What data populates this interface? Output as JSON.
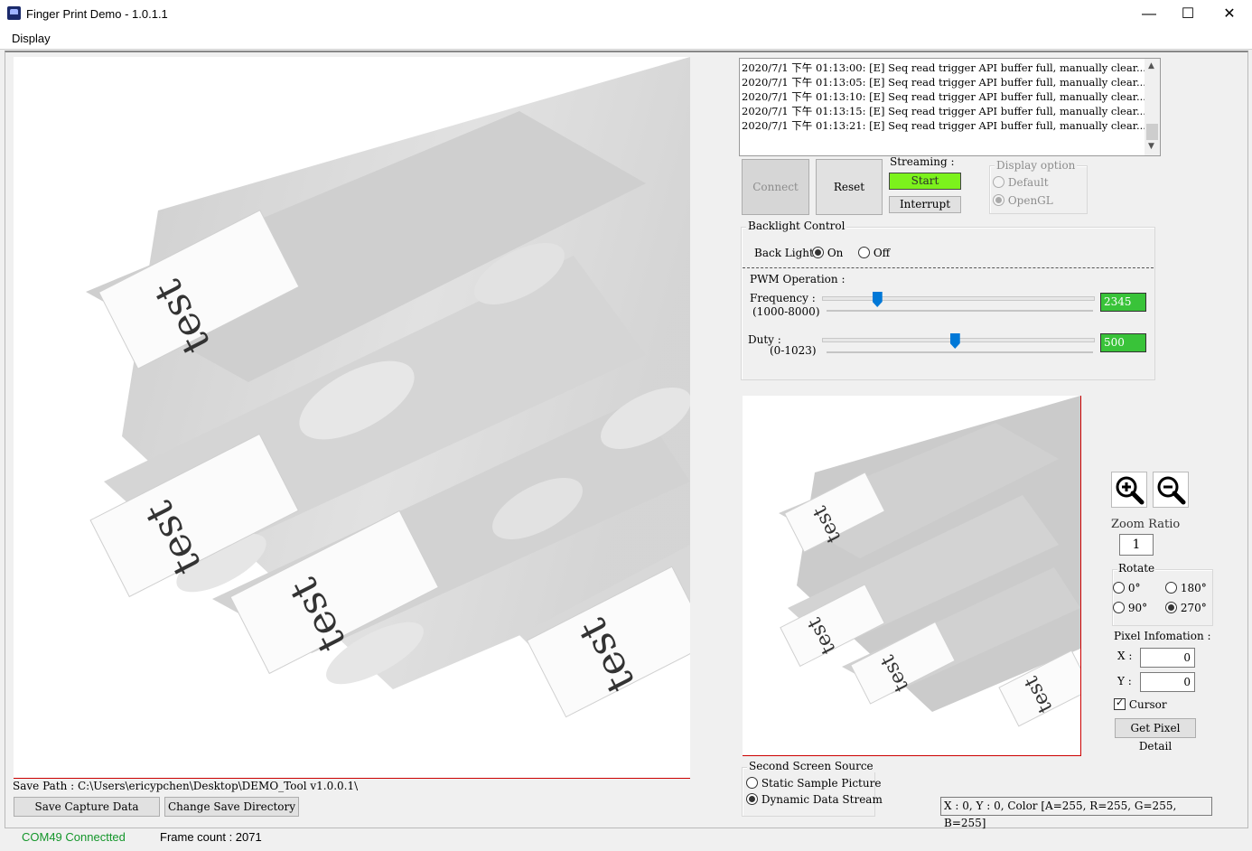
{
  "window": {
    "title": "Finger Print Demo - 1.0.1.1",
    "minimize": "—",
    "maximize": "☐",
    "close": "✕"
  },
  "menu": {
    "display": "Display"
  },
  "main_image": {
    "labels": [
      "test",
      "test",
      "test",
      "test"
    ]
  },
  "save": {
    "path_text": "Save Path : C:\\Users\\ericypchen\\Desktop\\DEMO_Tool v1.0.0.1\\",
    "save_button": "Save Capture Data",
    "change_dir_button": "Change Save Directory"
  },
  "status": {
    "connection": "COM49 Connectted",
    "frame_count": "Frame count : 2071",
    "connection_color": "#14962b"
  },
  "log": {
    "lines": [
      "2020/7/1 下午 01:13:00: [E] Seq read trigger API buffer full, manually clear....",
      "2020/7/1 下午 01:13:05: [E] Seq read trigger API buffer full, manually clear....",
      "2020/7/1 下午 01:13:10: [E] Seq read trigger API buffer full, manually clear....",
      "2020/7/1 下午 01:13:15: [E] Seq read trigger API buffer full, manually clear....",
      "2020/7/1 下午 01:13:21: [E] Seq read trigger API buffer full, manually clear...."
    ]
  },
  "controls": {
    "connect": "Connect",
    "reset": "Reset",
    "streaming_label": "Streaming :",
    "start": "Start",
    "interrupt": "Interrupt",
    "display_option": {
      "title": "Display option",
      "default": "Default",
      "opengl": "OpenGL",
      "selected": "OpenGL"
    }
  },
  "backlight": {
    "title": "Backlight Control",
    "label": "Back Light :",
    "on": "On",
    "off": "Off",
    "selected": "On"
  },
  "pwm": {
    "title": "PWM Operation :",
    "frequency": {
      "label": "Frequency :",
      "range": "(1000-8000)",
      "value": "2345",
      "min": 1000,
      "max": 8000,
      "current": 2345
    },
    "duty": {
      "label": "Duty :",
      "range": "(0-1023)",
      "value": "500",
      "min": 0,
      "max": 1023,
      "current": 500
    }
  },
  "zoom": {
    "label": "Zoom Ratio",
    "value": "1",
    "zoom_in_icon": "zoom-in-icon",
    "zoom_out_icon": "zoom-out-icon"
  },
  "rotate": {
    "title": "Rotate",
    "options": [
      "0°",
      "180°",
      "90°",
      "270°"
    ],
    "selected": "270°"
  },
  "pixel": {
    "title": "Pixel Infomation :",
    "x_label": "X :",
    "x_value": "0",
    "y_label": "Y :",
    "y_value": "0",
    "cursor_label": "Cursor",
    "cursor_checked": true,
    "get_detail": "Get Pixel Detail",
    "readout": "X : 0, Y : 0, Color [A=255, R=255, G=255, B=255]"
  },
  "second_screen": {
    "title": "Second Screen Source",
    "static": "Static Sample Picture",
    "dynamic": "Dynamic Data Stream",
    "selected": "Dynamic Data Stream"
  }
}
